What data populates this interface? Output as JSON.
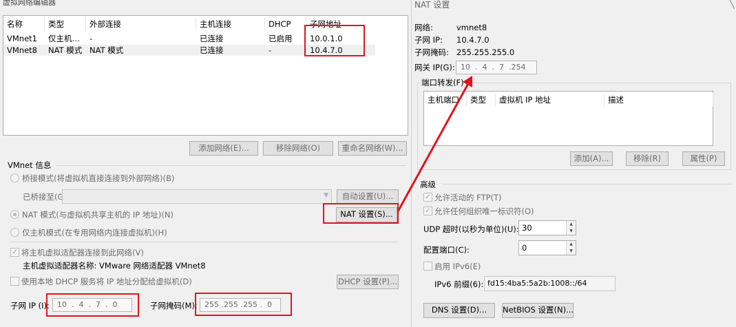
{
  "left": {
    "title_fragment": "虚拟网络编辑器",
    "table": {
      "headers": [
        "名称",
        "类型",
        "外部连接",
        "主机连接",
        "DHCP",
        "子网地址"
      ],
      "rows": [
        [
          "VMnet1",
          "仅主机…",
          "-",
          "已连接",
          "已启用",
          "10.0.1.0"
        ],
        [
          "VMnet8",
          "NAT 模式",
          "NAT 模式",
          "已连接",
          "-",
          "10.4.7.0"
        ]
      ]
    },
    "buttons": {
      "add_network": "添加网络(E)...",
      "remove_network": "移除网络(O)",
      "rename_network": "重命名网络(W)..."
    },
    "info": {
      "section_title": "VMnet 信息",
      "bridged_mode": "桥接模式(将虚拟机直接连接到外部网络)(B)",
      "bridged_to_label": "已桥接至(G):",
      "auto_settings": "自动设置(U)...",
      "nat_mode": "NAT 模式(与虚拟机共享主机的 IP 地址)(N)",
      "nat_settings": "NAT 设置(S)...",
      "host_only_mode": "仅主机模式(在专用网络内连接虚拟机)(H)",
      "connect_host_adapter": "将主机虚拟适配器连接到此网络(V)",
      "host_adapter_name": "主机虚拟适配器名称: VMware 网络适配器 VMnet8",
      "use_dhcp": "使用本地 DHCP 服务将 IP 地址分配给虚拟机(D)",
      "dhcp_settings": "DHCP 设置(P)...",
      "subnet_ip_label": "子网 IP (I):",
      "subnet_ip_value": "10  .  4  .  7  .  0",
      "subnet_mask_label": "子网掩码(M):",
      "subnet_mask_value": "255 .255 .255 .  0"
    }
  },
  "nat": {
    "title": "NAT 设置",
    "network_label": "网络:",
    "network_value": "vmnet8",
    "subnet_ip_label": "子网 IP:",
    "subnet_ip_value": "10.4.7.0",
    "subnet_mask_label": "子网掩码:",
    "subnet_mask_value": "255.255.255.0",
    "gateway_label": "网关 IP(G):",
    "gateway_value": "10  .  4  .  7  .254",
    "port_forwarding": {
      "title": "端口转发(F)",
      "headers": [
        "主机端口",
        "类型",
        "虚拟机 IP 地址",
        "描述"
      ],
      "add": "添加(A)...",
      "remove": "移除(R)",
      "properties": "属性(P)"
    },
    "advanced": {
      "title": "高级",
      "allow_active_ftp": "允许活动的 FTP(T)",
      "allow_any_oui": "允许任何组织唯一标识符(O)",
      "udp_timeout_label": "UDP 超时(以秒为单位)(U):",
      "udp_timeout_value": "30",
      "config_port_label": "配置端口(C):",
      "config_port_value": "0",
      "enable_ipv6": "启用 IPv6(E)",
      "ipv6_prefix_label": "IPv6 前缀(6):",
      "ipv6_prefix_value": "fd15:4ba5:5a2b:1008::/64"
    },
    "dns_settings": "DNS 设置(D)...",
    "netbios_settings": "NetBIOS 设置(N)..."
  },
  "colors": {
    "annotation_red": "#e0141e"
  }
}
